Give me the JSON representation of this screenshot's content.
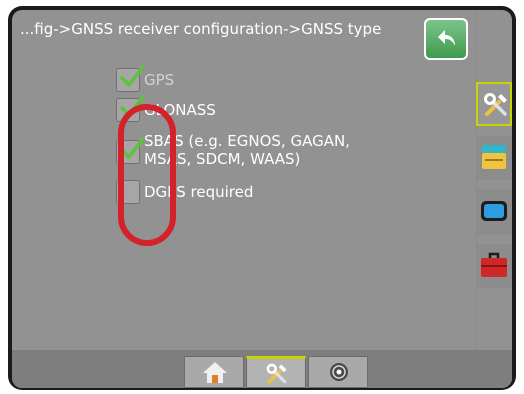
{
  "header": {
    "breadcrumb": "...fig->GNSS receiver configuration->GNSS type"
  },
  "options": [
    {
      "label": "GPS",
      "checked": true,
      "enabled": false
    },
    {
      "label": "GLONASS",
      "checked": true,
      "enabled": true
    },
    {
      "label": "SBAS (e.g. EGNOS, GAGAN, MSAS, SDCM, WAAS)",
      "label_line1": "SBAS (e.g. EGNOS, GAGAN,",
      "label_line2": "MSAS, SDCM, WAAS)",
      "checked": true,
      "enabled": true
    },
    {
      "label": "DGPS required",
      "checked": false,
      "enabled": true
    }
  ],
  "side_tabs": [
    "tools-icon",
    "console-icon",
    "display-icon",
    "toolbox-icon"
  ],
  "bottom_tabs": [
    "home-icon",
    "tools-icon",
    "gnss-icon"
  ],
  "colors": {
    "screen_bg": "#929292",
    "accent": "#c6d400",
    "back_button": "#4caf50",
    "check": "#5cc33c",
    "annotation": "#d3222a"
  }
}
